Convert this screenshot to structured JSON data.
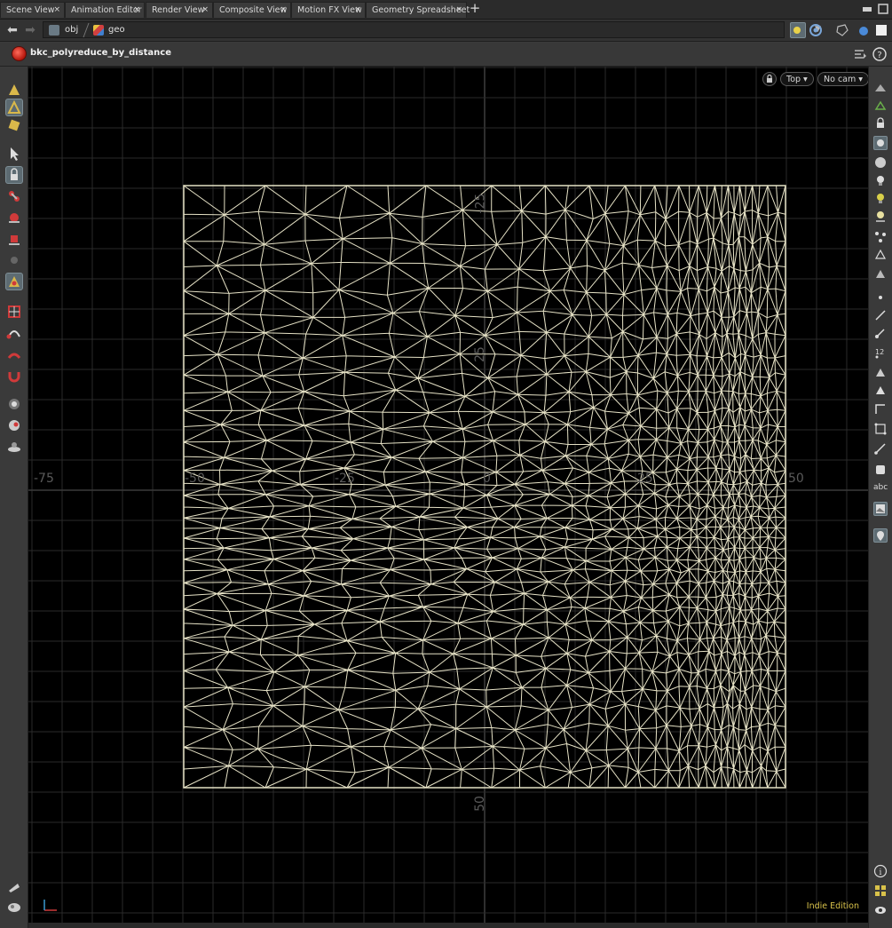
{
  "tabs": [
    {
      "label": "Scene View"
    },
    {
      "label": "Animation Editor"
    },
    {
      "label": "Render View"
    },
    {
      "label": "Composite View"
    },
    {
      "label": "Motion FX View"
    },
    {
      "label": "Geometry Spreadsheet"
    }
  ],
  "tab_close": "×",
  "tab_add": "+",
  "path": {
    "back": "⬅",
    "forward": "➡",
    "crumbs": [
      "obj",
      "geo"
    ],
    "dropdown": "▼"
  },
  "node": {
    "name": "bkc_polyreduce_by_distance"
  },
  "viewport": {
    "view_menu": "Top ▾",
    "camera_menu": "No cam ▾",
    "edition": "Indie Edition",
    "axis_labels": {
      "x_neg75": "-75",
      "x_neg50": "-50",
      "x_neg25": "-25",
      "x_zero": "0",
      "x_25": "25",
      "x_50": "50",
      "y_neg25": "-25",
      "y_25": "25",
      "y_50": "50"
    }
  },
  "right_toolbar": {
    "text_tool": "abc",
    "info_icon": "i"
  },
  "colors": {
    "wire": "#e6e2c6",
    "grid": "#2a2a2a",
    "viewport_bg": "#000000",
    "accent_edition": "#d9c24a"
  }
}
